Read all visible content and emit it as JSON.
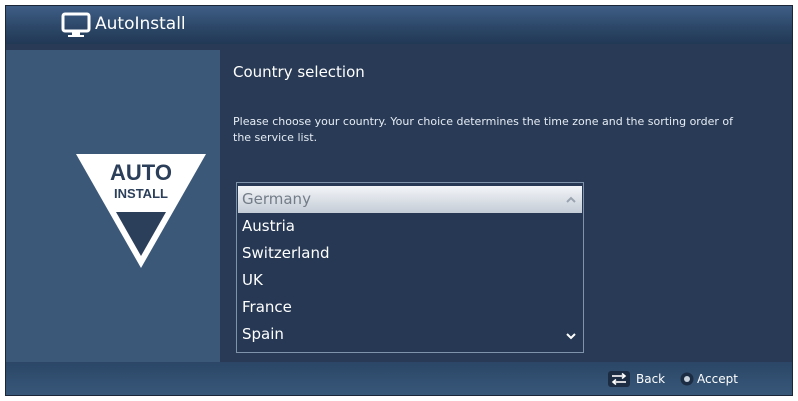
{
  "window": {
    "title": "AutoInstall",
    "icon": "tv-icon"
  },
  "logo": {
    "line1": "AUTO",
    "line2": "INSTALL"
  },
  "main": {
    "heading": "Country selection",
    "description": "Please choose your country. Your choice determines the time zone and the sorting order of the service list."
  },
  "country_list": {
    "selected": "Germany",
    "items": [
      "Germany",
      "Austria",
      "Switzerland",
      "UK",
      "France",
      "Spain"
    ]
  },
  "footer": {
    "back_label": "Back",
    "accept_label": "Accept"
  },
  "colors": {
    "background": "#283a55",
    "panel": "#3b5878",
    "selection": "#d9dee5"
  }
}
